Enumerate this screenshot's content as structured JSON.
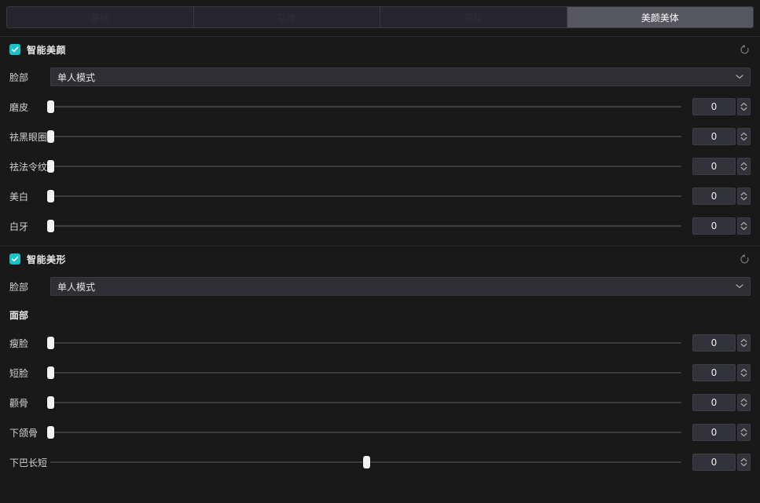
{
  "tabs": [
    {
      "label": "基础",
      "active": false
    },
    {
      "label": "抠像",
      "active": false
    },
    {
      "label": "蒙版",
      "active": false
    },
    {
      "label": "美颜美体",
      "active": true
    }
  ],
  "colors": {
    "accent": "#17c3c8",
    "active_tab_bg": "#56565f",
    "panel_bg": "#191919",
    "field_bg": "#32323a"
  },
  "sections": [
    {
      "title": "智能美颜",
      "checked": true,
      "reset_icon": "reset-icon",
      "select": {
        "label": "脸部",
        "value": "单人模式",
        "options": [
          "单人模式"
        ],
        "arrow_icon": "chevron-down-icon"
      },
      "sliders": [
        {
          "label": "磨皮",
          "value": "0",
          "percent": 0
        },
        {
          "label": "祛黑眼圈",
          "value": "0",
          "percent": 0
        },
        {
          "label": "祛法令纹",
          "value": "0",
          "percent": 0
        },
        {
          "label": "美白",
          "value": "0",
          "percent": 0
        },
        {
          "label": "白牙",
          "value": "0",
          "percent": 0
        }
      ]
    },
    {
      "title": "智能美形",
      "checked": true,
      "reset_icon": "reset-icon",
      "select": {
        "label": "脸部",
        "value": "单人模式",
        "options": [
          "单人模式"
        ],
        "arrow_icon": "chevron-down-icon"
      },
      "subhead": "面部",
      "sliders": [
        {
          "label": "瘦脸",
          "value": "0",
          "percent": 0
        },
        {
          "label": "短脸",
          "value": "0",
          "percent": 0
        },
        {
          "label": "颧骨",
          "value": "0",
          "percent": 0
        },
        {
          "label": "下颌骨",
          "value": "0",
          "percent": 0
        },
        {
          "label": "下巴长短",
          "value": "0",
          "percent": 50
        }
      ]
    }
  ]
}
